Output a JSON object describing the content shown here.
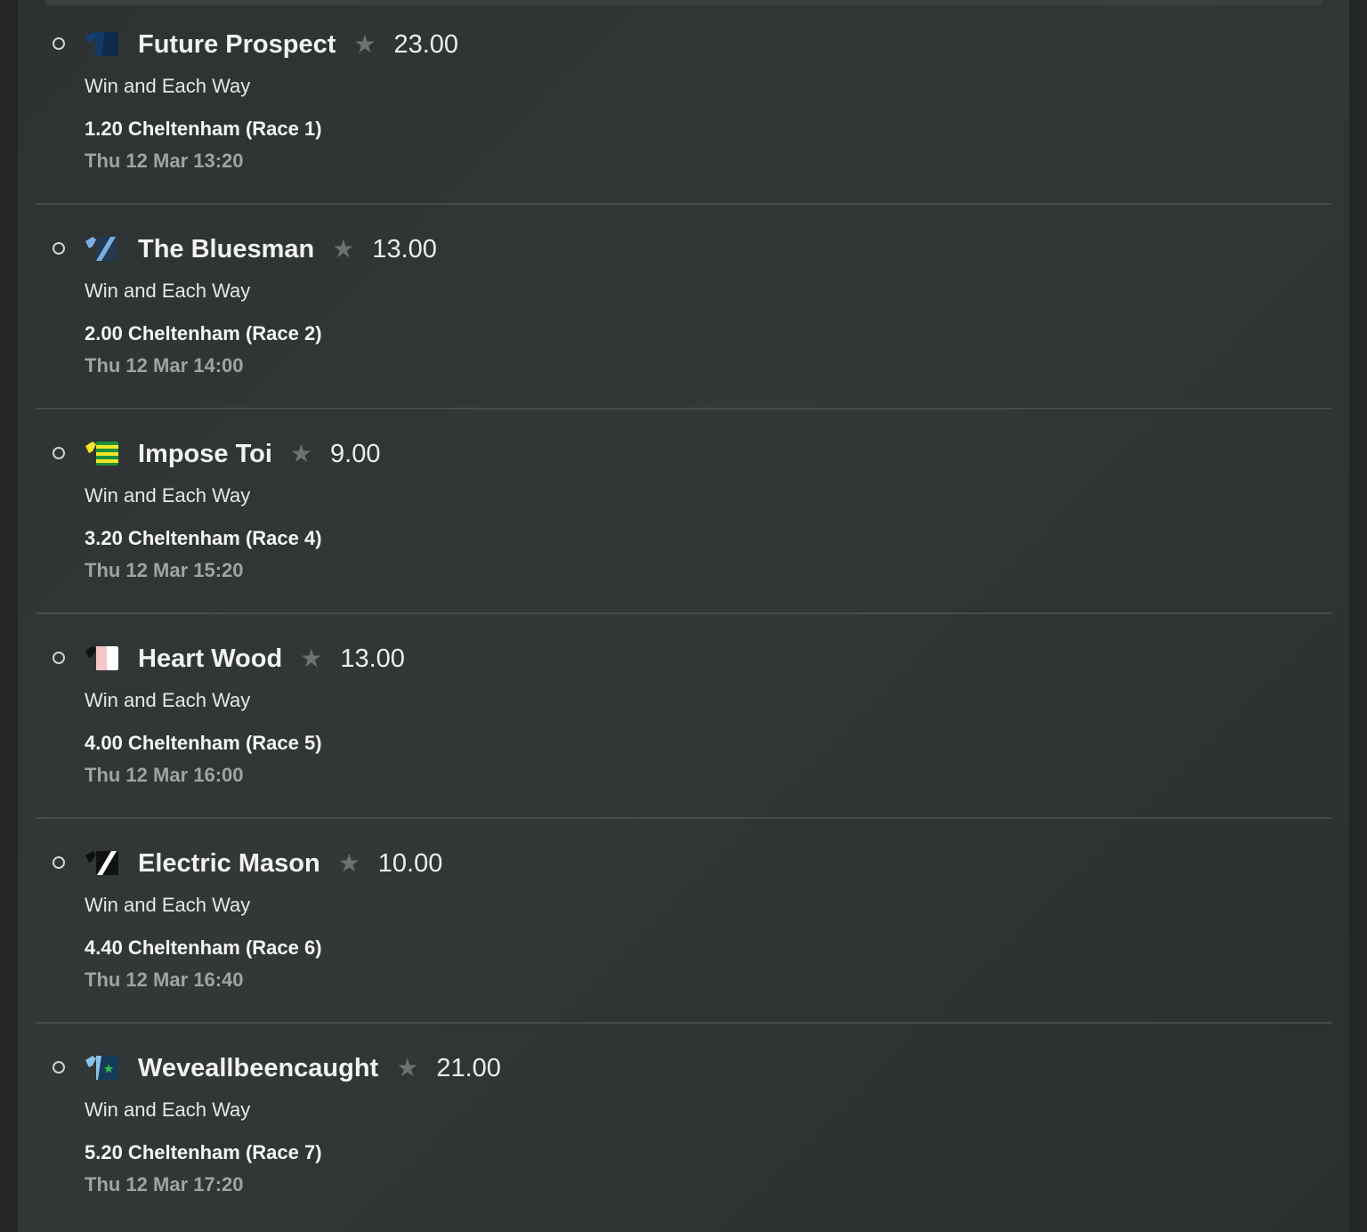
{
  "bets": [
    {
      "runner": "Future Prospect",
      "odds": "23.00",
      "market": "Win and Each Way",
      "race": "1.20 Cheltenham (Race 1)",
      "time": "Thu 12 Mar 13:20",
      "silk": {
        "icon": "silk-navy-icon",
        "colors": [
          "#0f2a4a",
          "#123a66"
        ]
      }
    },
    {
      "runner": "The Bluesman",
      "odds": "13.00",
      "market": "Win and Each Way",
      "race": "2.00 Cheltenham (Race 2)",
      "time": "Thu 12 Mar 14:00",
      "silk": {
        "icon": "silk-blue-sash-icon",
        "colors": [
          "#7aaee0",
          "#24384f"
        ]
      }
    },
    {
      "runner": "Impose Toi",
      "odds": "9.00",
      "market": "Win and Each Way",
      "race": "3.20 Cheltenham (Race 4)",
      "time": "Thu 12 Mar 15:20",
      "silk": {
        "icon": "silk-green-yellow-hoops-icon",
        "colors": [
          "#1c8f3a",
          "#f2e628"
        ]
      }
    },
    {
      "runner": "Heart Wood",
      "odds": "13.00",
      "market": "Win and Each Way",
      "race": "4.00 Cheltenham (Race 5)",
      "time": "Thu 12 Mar 16:00",
      "silk": {
        "icon": "silk-pink-white-icon",
        "colors": [
          "#f6c5c8",
          "#ffffff"
        ]
      }
    },
    {
      "runner": "Electric Mason",
      "odds": "10.00",
      "market": "Win and Each Way",
      "race": "4.40 Cheltenham (Race 6)",
      "time": "Thu 12 Mar 16:40",
      "silk": {
        "icon": "silk-black-white-sash-icon",
        "colors": [
          "#111111",
          "#ffffff"
        ]
      }
    },
    {
      "runner": "Weveallbeencaught",
      "odds": "21.00",
      "market": "Win and Each Way",
      "race": "5.20 Cheltenham (Race 7)",
      "time": "Thu 12 Mar 17:20",
      "silk": {
        "icon": "silk-lightblue-navy-star-icon",
        "colors": [
          "#8cc3e6",
          "#163a5a",
          "#2dbb4a"
        ]
      }
    }
  ]
}
